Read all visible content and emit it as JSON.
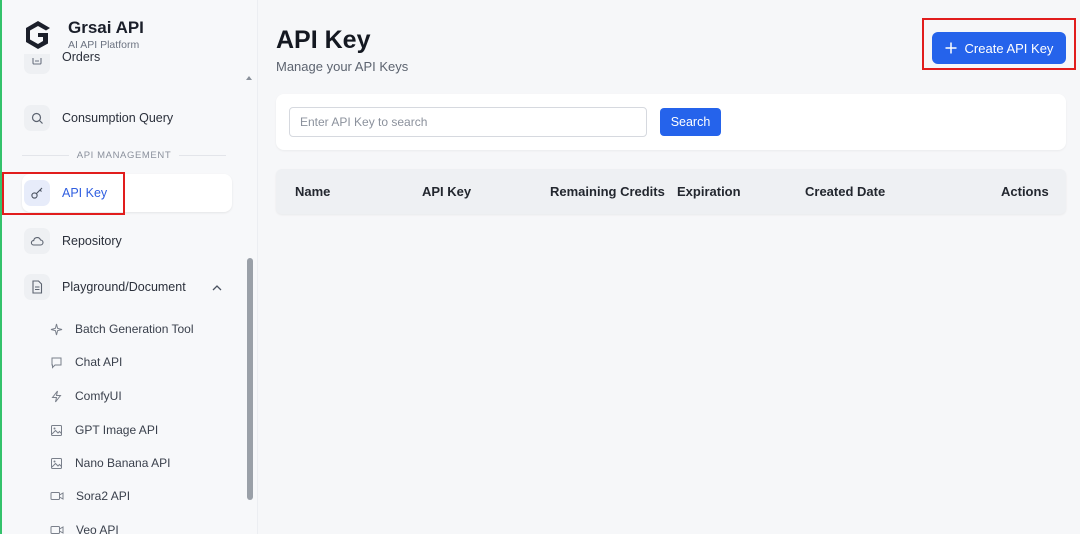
{
  "brand": {
    "name": "Grsai API",
    "subtitle": "AI API Platform"
  },
  "sidebar": {
    "partial_item": {
      "label": "Orders",
      "icon": "orders-icon"
    },
    "items": [
      {
        "label": "Consumption Query",
        "icon": "search-icon"
      }
    ],
    "section_title": "API MANAGEMENT",
    "management_items": [
      {
        "label": "API Key",
        "icon": "key-icon",
        "active": true
      },
      {
        "label": "Repository",
        "icon": "cloud-icon"
      },
      {
        "label": "Playground/Document",
        "icon": "document-icon",
        "expanded": true
      }
    ],
    "sub_items": [
      {
        "label": "Batch Generation Tool",
        "icon": "sparkle-icon"
      },
      {
        "label": "Chat API",
        "icon": "chat-icon"
      },
      {
        "label": "ComfyUI",
        "icon": "bolt-icon"
      },
      {
        "label": "GPT Image API",
        "icon": "image-icon"
      },
      {
        "label": "Nano Banana API",
        "icon": "image-icon"
      },
      {
        "label": "Sora2 API",
        "icon": "video-icon"
      },
      {
        "label": "Veo API",
        "icon": "video-icon"
      }
    ]
  },
  "header": {
    "title": "API Key",
    "subtitle": "Manage your API Keys",
    "create_label": "Create API Key"
  },
  "search": {
    "placeholder": "Enter API Key to search",
    "value": "",
    "button_label": "Search"
  },
  "table": {
    "columns": [
      "Name",
      "API Key",
      "Remaining Credits",
      "Expiration",
      "Created Date",
      "Actions"
    ],
    "rows": []
  },
  "colors": {
    "primary": "#2563eb",
    "highlight": "#e11d1d",
    "active_text": "#2f5ee0"
  }
}
